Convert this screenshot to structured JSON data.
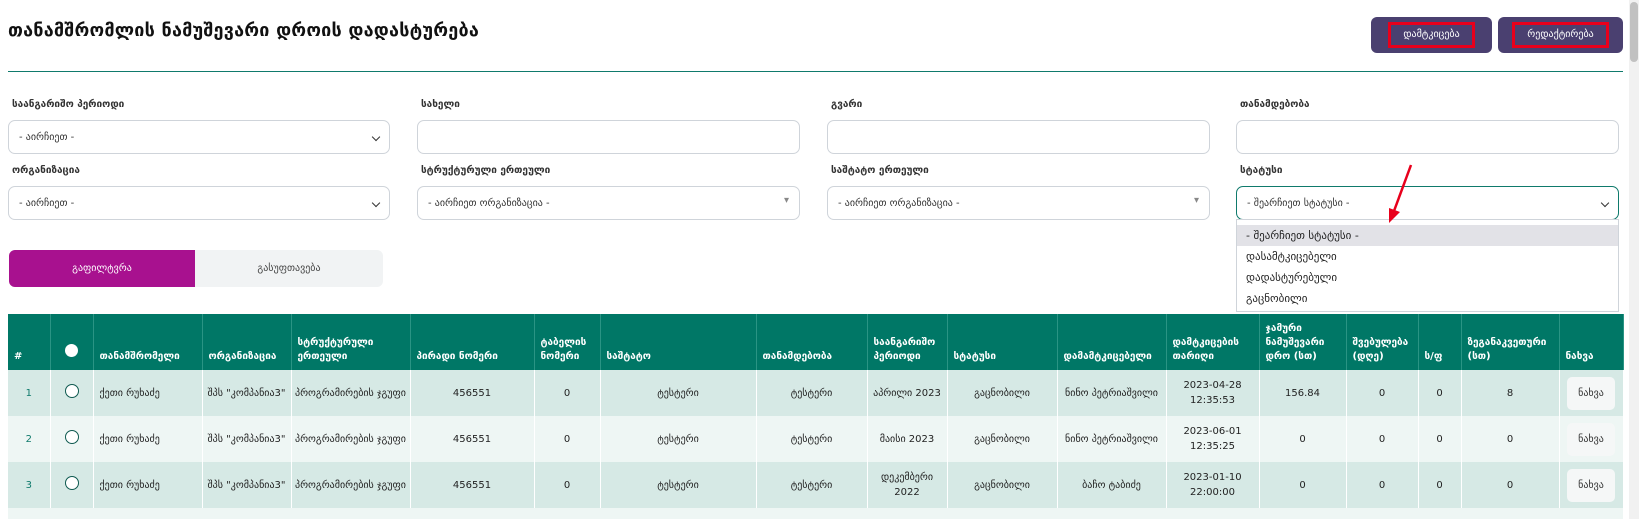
{
  "page": {
    "title": "თანამშრომლის ნამუშევარი დროის დადასტურება",
    "approve_label": "დამტკიცება",
    "edit_label": "რედაქტირება"
  },
  "filters": {
    "period": {
      "label": "საანგარიშო პერიოდი",
      "value": "- აირჩიეთ -"
    },
    "name": {
      "label": "სახელი",
      "value": ""
    },
    "surname": {
      "label": "გვარი",
      "value": ""
    },
    "position": {
      "label": "თანამდებობა",
      "value": ""
    },
    "organization": {
      "label": "ორგანიზაცია",
      "value": "- აირჩიეთ -"
    },
    "structural_unit": {
      "label": "სტრუქტურული ერთეული",
      "value": "- აირჩიეთ ორგანიზაცია -"
    },
    "staff_unit": {
      "label": "საშტატო ერთეული",
      "value": "- აირჩიეთ ორგანიზაცია -"
    },
    "status": {
      "label": "სტატუსი",
      "value": "- შეარჩიეთ სტატუსი -",
      "options": [
        "- შეარჩიეთ სტატუსი -",
        "დასამტკიცებელი",
        "დადასტურებული",
        "გაცნობილი"
      ]
    }
  },
  "actions": {
    "filter_label": "გაფილტვრა",
    "clear_label": "გასუფთავება"
  },
  "table": {
    "columns": [
      "#",
      "",
      "თანამშრომელი",
      "ორგანიზაცია",
      "სტრუქტურული ერთეული",
      "პირადი ნომერი",
      "ტაბელის ნომერი",
      "საშტატო",
      "თანამდებობა",
      "საანგარიშო პერიოდი",
      "სტატუსი",
      "დამამტკიცებელი",
      "დამტკიცების თარიღი",
      "ჯამური ნამუშევარი დრო (სთ)",
      "შვებულება (დღე)",
      "ს/ფ",
      "ზეგანაკვეთური (სთ)",
      "ნახვა"
    ],
    "rows": [
      {
        "n": "1",
        "employee": "ქეთი რუხაძე",
        "org": "შპს \"კომპანია3\"",
        "unit": "პროგრამირების ჯგუფი",
        "pid": "456551",
        "tab": "0",
        "staff": "ტესტერი",
        "pos": "ტესტერი",
        "period": "აპრილი 2023",
        "status": "გაცნობილი",
        "approver": "ნინო პეტრიაშვილი",
        "date": "2023-04-28 12:35:53",
        "hours": "156.84",
        "vac": "0",
        "sick": "0",
        "ot": "8",
        "view": "ნახვა"
      },
      {
        "n": "2",
        "employee": "ქეთი რუხაძე",
        "org": "შპს \"კომპანია3\"",
        "unit": "პროგრამირების ჯგუფი",
        "pid": "456551",
        "tab": "0",
        "staff": "ტესტერი",
        "pos": "ტესტერი",
        "period": "მაისი 2023",
        "status": "გაცნობილი",
        "approver": "ნინო პეტრიაშვილი",
        "date": "2023-06-01 12:35:25",
        "hours": "0",
        "vac": "0",
        "sick": "0",
        "ot": "0",
        "view": "ნახვა"
      },
      {
        "n": "3",
        "employee": "ქეთი რუხაძე",
        "org": "შპს \"კომპანია3\"",
        "unit": "პროგრამირების ჯგუფი",
        "pid": "456551",
        "tab": "0",
        "staff": "ტესტერი",
        "pos": "ტესტერი",
        "period": "დეკემბერი 2022",
        "status": "გაცნობილი",
        "approver": "ბაჩო ტაბიძე",
        "date": "2023-01-10 22:00:00",
        "hours": "0",
        "vac": "0",
        "sick": "0",
        "ot": "0",
        "view": "ნახვა"
      }
    ]
  },
  "colors": {
    "header": "#007766",
    "accent": "#a8118f",
    "top_button": "#4a4070",
    "highlight": "#e8001c"
  }
}
